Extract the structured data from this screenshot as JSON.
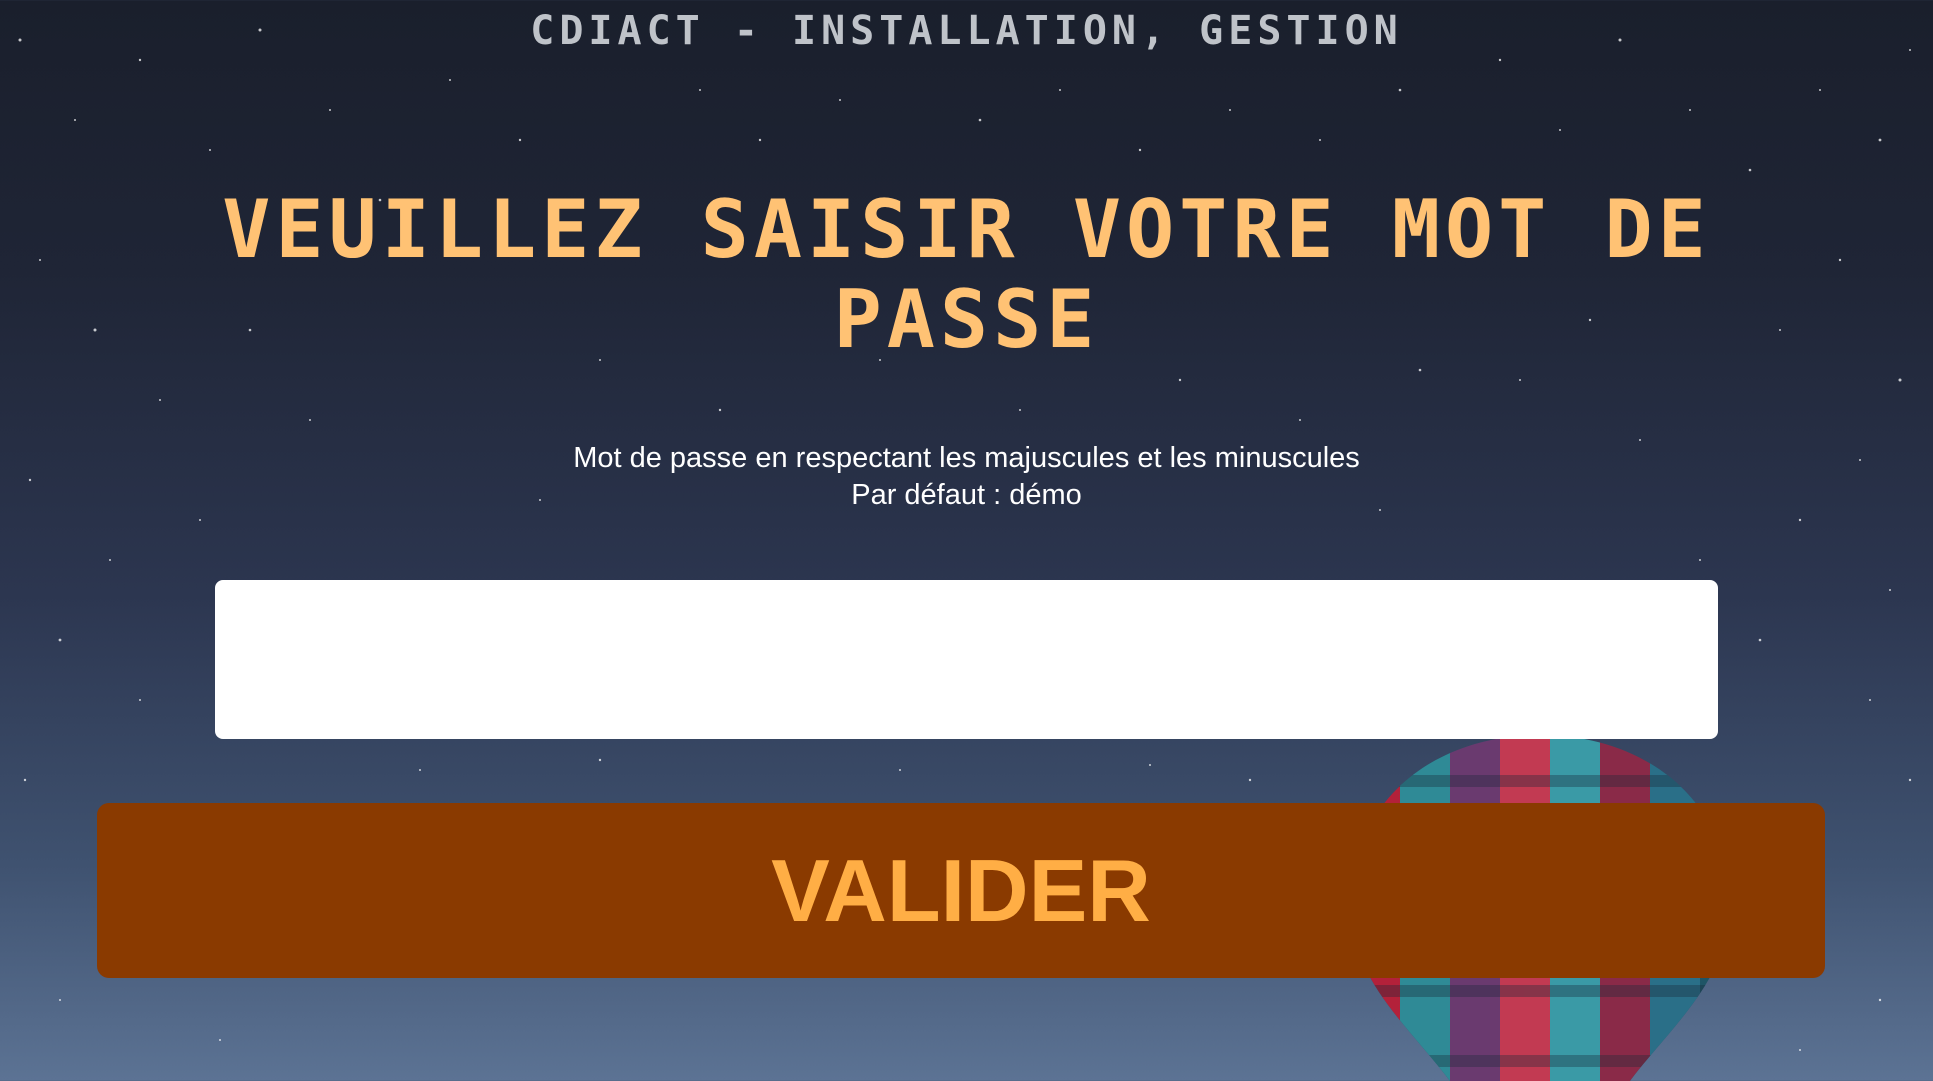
{
  "header": {
    "title": "CDIACT - INSTALLATION, GESTION"
  },
  "main": {
    "heading": "VEUILLEZ SAISIR VOTRE MOT DE PASSE",
    "instructions": {
      "line1": "Mot de passe en respectant les majuscules et les minuscules",
      "line2": "Par défaut : démo"
    },
    "password_field": {
      "value": "",
      "placeholder": ""
    },
    "submit_label": "VALIDER"
  },
  "colors": {
    "heading": "#ffc274",
    "header_text": "#bfc3c9",
    "button_background": "#8a3a00",
    "button_text": "#ffae45",
    "input_background": "#ffffff"
  },
  "background": {
    "image": "night sky with stars and a hot air balloon"
  }
}
